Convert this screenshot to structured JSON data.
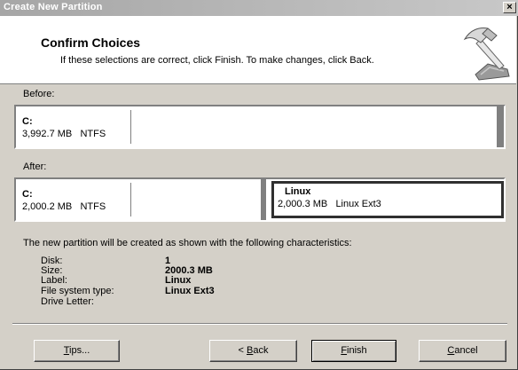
{
  "window": {
    "title": "Create New Partition",
    "close_glyph": "×"
  },
  "header": {
    "title": "Confirm Choices",
    "subtitle": "If these selections are correct, click Finish. To make changes, click Back.",
    "icon": "hammer-icon"
  },
  "before": {
    "label": "Before:",
    "partition": {
      "name": "C:",
      "size": "3,992.7 MB",
      "fs": "NTFS"
    }
  },
  "after": {
    "label": "After:",
    "partitions": [
      {
        "name": "C:",
        "size": "2,000.2 MB",
        "fs": "NTFS"
      },
      {
        "name": "Linux",
        "size": "2,000.3 MB",
        "fs": "Linux Ext3"
      }
    ]
  },
  "characteristics": {
    "intro": "The new partition will be created as shown with the following characteristics:",
    "rows": [
      {
        "label": "Disk:",
        "value": "1"
      },
      {
        "label": "Size:",
        "value": "2000.3 MB"
      },
      {
        "label": "Label:",
        "value": "Linux"
      },
      {
        "label": "File system type:",
        "value": "Linux Ext3"
      },
      {
        "label": "Drive Letter:",
        "value": ""
      }
    ]
  },
  "buttons": {
    "tips": {
      "pre": "",
      "key": "T",
      "post": "ips..."
    },
    "back": {
      "pre": "< ",
      "key": "B",
      "post": "ack"
    },
    "finish": {
      "pre": "",
      "key": "F",
      "post": "inish"
    },
    "cancel": {
      "pre": "",
      "key": "C",
      "post": "ancel"
    }
  }
}
